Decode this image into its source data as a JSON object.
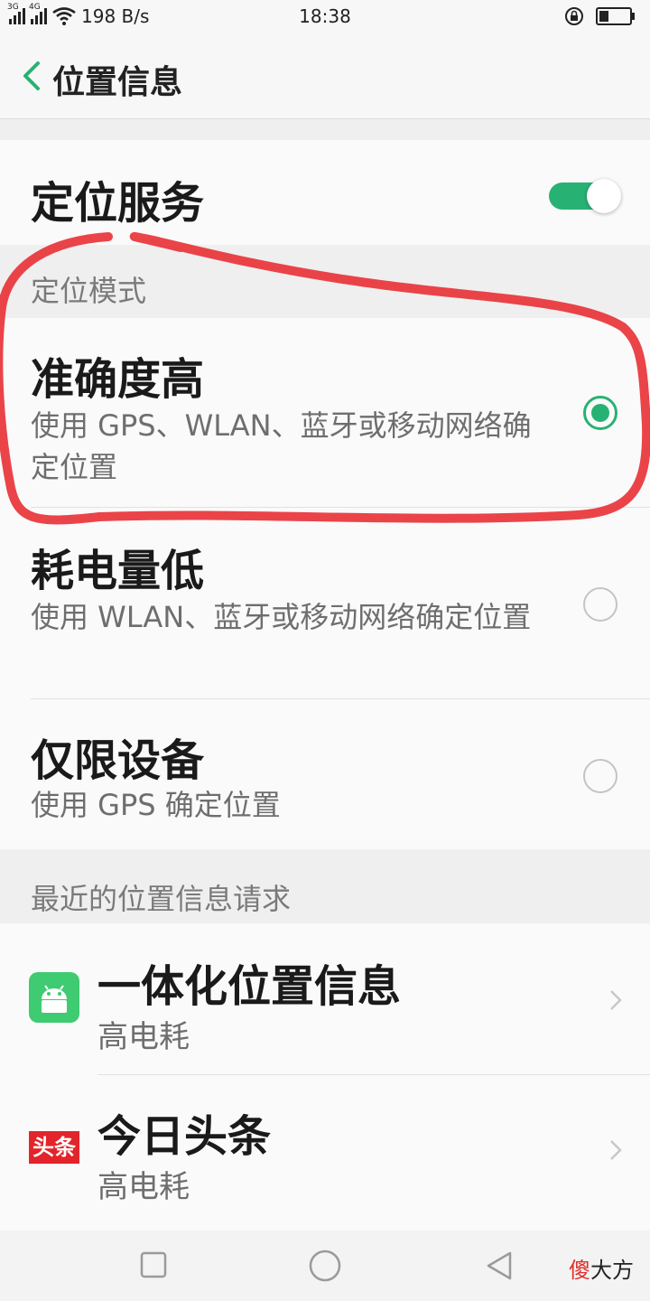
{
  "status_bar": {
    "net_tag_1": "3G",
    "net_tag_2": "4G",
    "speed": "198 B/s",
    "time": "18:38"
  },
  "header": {
    "title": "位置信息",
    "back_icon": "chevron-left-icon"
  },
  "location_service": {
    "label": "定位服务",
    "enabled": true,
    "accent": "#27b273"
  },
  "mode_section": {
    "header": "定位模式",
    "options": [
      {
        "title": "准确度高",
        "desc": "使用 GPS、WLAN、蓝牙或移动网络确定位置",
        "selected": true
      },
      {
        "title": "耗电量低",
        "desc": "使用 WLAN、蓝牙或移动网络确定位置",
        "selected": false
      },
      {
        "title": "仅限设备",
        "desc": "使用 GPS 确定位置",
        "selected": false
      }
    ]
  },
  "recent_section": {
    "header": "最近的位置信息请求",
    "apps": [
      {
        "name": "一体化位置信息",
        "usage": "高电耗",
        "icon": "android-icon"
      },
      {
        "name": "今日头条",
        "usage": "高电耗",
        "icon": "toutiao-icon",
        "icon_text": "头条"
      }
    ]
  },
  "nav_bar": {
    "watermark_red": "傻",
    "watermark_black": "大方"
  },
  "colors": {
    "annotation": "#e8343a",
    "toutiao_red": "#e2242b",
    "android_green": "#3ecb72"
  }
}
